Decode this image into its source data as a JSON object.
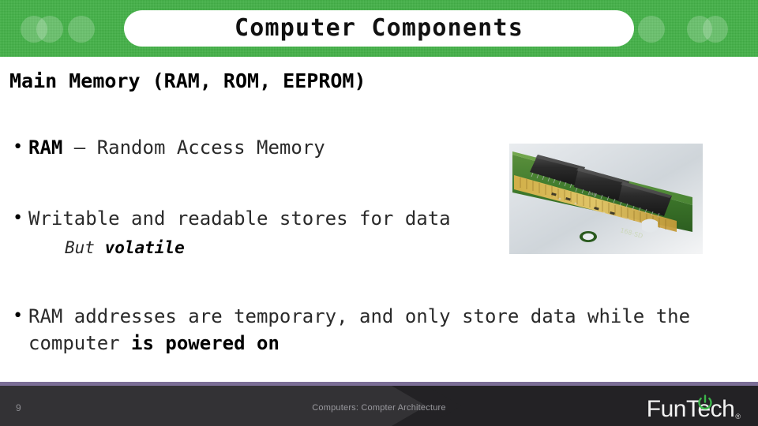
{
  "slide": {
    "title": "Computer Components",
    "heading": "Main Memory (RAM, ROM, EEPROM)",
    "bullets": [
      {
        "strong": "RAM",
        "rest": " – Random Access Memory"
      },
      {
        "strong": "",
        "rest": "Writable and readable stores for data"
      }
    ],
    "subline": {
      "lead": "But ",
      "emphasis": "volatile"
    },
    "bullet3": {
      "plain_start": "RAM addresses are temporary, and only store data while the computer ",
      "strong_end": "is powered on"
    },
    "image": {
      "alt": "ram-memory-module-photo",
      "caption": ""
    }
  },
  "footer": {
    "page_number": "9",
    "center_text": "Computers: Compter Architecture",
    "brand_name": "FunTech",
    "brand_registered": "®",
    "power_icon": "power-symbol"
  },
  "colors": {
    "header_green": "#43b147",
    "footer_dark": "#333235",
    "footer_darker": "#232225",
    "footer_rule_purple": "#7b6e96",
    "brand_green": "#3cb44a",
    "title_text": "#111111",
    "body_text": "#2a2a2a"
  }
}
